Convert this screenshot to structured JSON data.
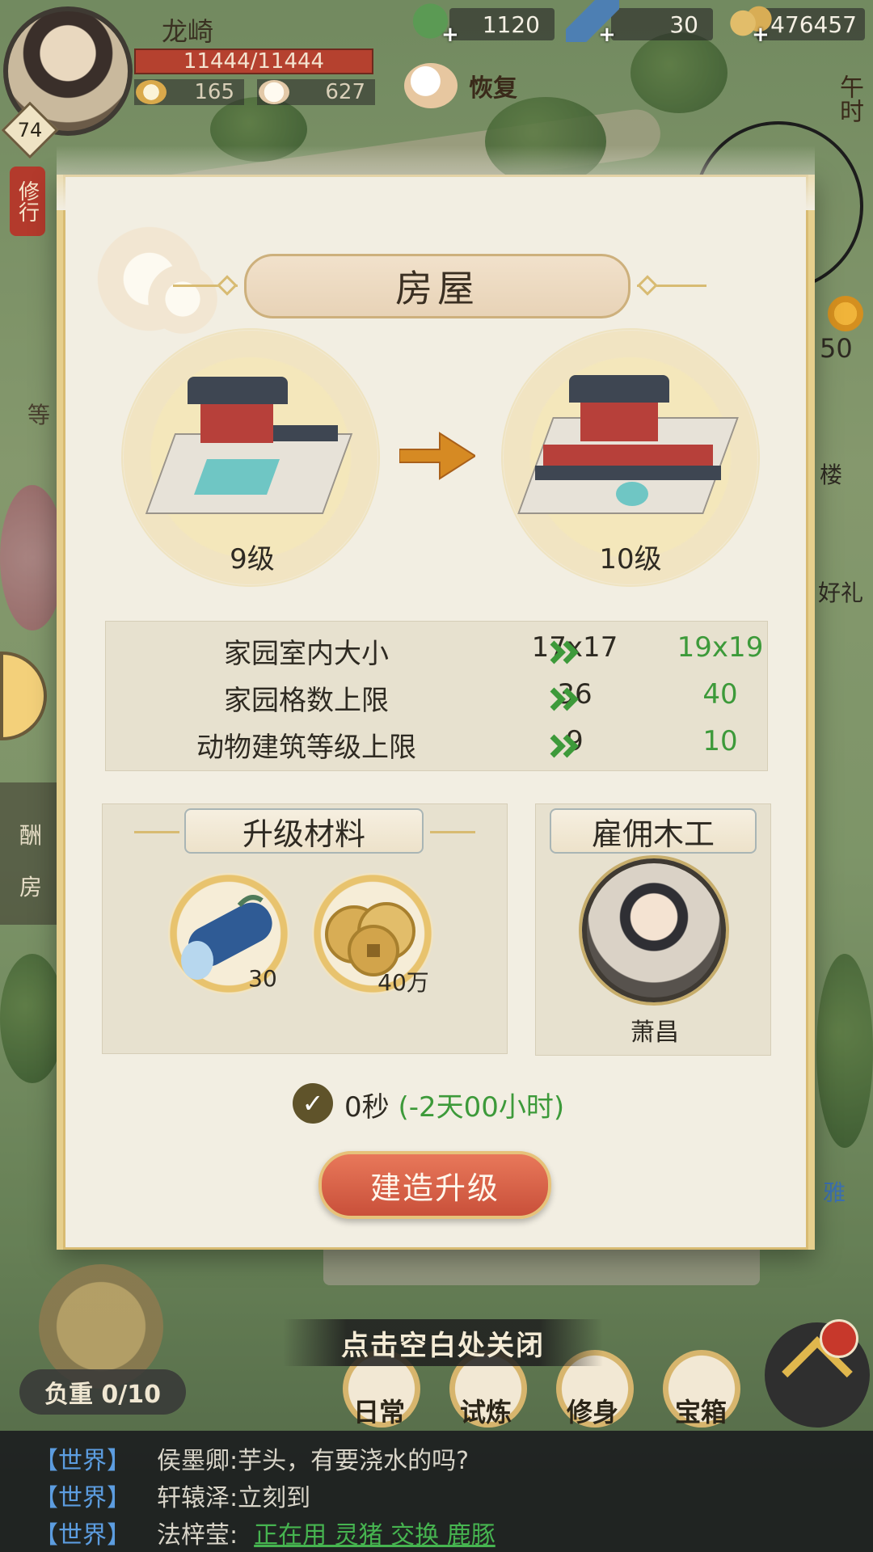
{
  "player": {
    "name": "龙崎",
    "level": "74",
    "hp": "11444/11444",
    "stat_a": "165",
    "stat_b": "627",
    "recover_label": "恢复"
  },
  "resources": {
    "jade": "1120",
    "wood": "30",
    "coins": "476457"
  },
  "side": {
    "practice_label": "修行",
    "time_of_day": "午时",
    "sun_value": "50",
    "right_label_1": "楼",
    "right_label_2": "好礼",
    "right_label_3": "雅",
    "left_label_1": "酬",
    "left_label_2": "房",
    "left_label_3": "等"
  },
  "dialog": {
    "title": "房屋",
    "current_level": "9级",
    "next_level": "10级",
    "stats": [
      {
        "name": "家园室内大小",
        "current": "17x17",
        "next": "19x19"
      },
      {
        "name": "家园格数上限",
        "current": "36",
        "next": "40"
      },
      {
        "name": "动物建筑等级上限",
        "current": "9",
        "next": "10"
      }
    ],
    "materials_title": "升级材料",
    "materials": [
      {
        "icon": "wood-log-icon",
        "count": "30"
      },
      {
        "icon": "copper-coins-icon",
        "count": "40万"
      }
    ],
    "hire_title": "雇佣木工",
    "carpenter_name": "萧昌",
    "time_value": "0秒",
    "time_reduction": "(-2天00小时)",
    "build_button": "建造升级"
  },
  "bottom": {
    "close_hint": "点击空白处关闭",
    "load": "负重 0/10",
    "nav": [
      "日常",
      "试炼",
      "修身",
      "宝箱"
    ]
  },
  "chat": [
    {
      "channel": "【世界】",
      "user": "侯墨卿:",
      "msg": "芋头，有要浇水的吗?",
      "link": ""
    },
    {
      "channel": "【世界】",
      "user": "轩辕泽:",
      "msg": "立刻到",
      "link": ""
    },
    {
      "channel": "【世界】",
      "user": "法梓莹:",
      "msg": "",
      "link": "正在用 灵猪 交换 鹿豚"
    }
  ],
  "colors": {
    "accent_red": "#c9503a",
    "upgrade_green": "#3d9a3a",
    "chat_channel_blue": "#5c9de0",
    "panel_bg": "#f2eee2",
    "gold_border": "#e6cf8d"
  }
}
